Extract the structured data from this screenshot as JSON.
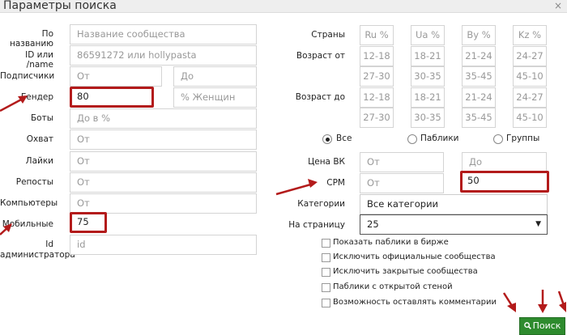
{
  "window": {
    "title": "Параметры поиска",
    "close_glyph": "×"
  },
  "left": {
    "by_name": {
      "label": "По названию",
      "placeholder": "Название сообщества"
    },
    "id_name": {
      "label": "ID или /name",
      "placeholder": "86591272 или hollypasta"
    },
    "subscribers": {
      "label": "Подписчики",
      "from": "От",
      "to": "До"
    },
    "gender": {
      "label": "Гендер",
      "value": "80",
      "suffix": "% Женщин"
    },
    "bots": {
      "label": "Боты",
      "placeholder": "До в %"
    },
    "reach": {
      "label": "Охват",
      "placeholder": "От"
    },
    "likes": {
      "label": "Лайки",
      "placeholder": "От"
    },
    "reposts": {
      "label": "Репосты",
      "placeholder": "От"
    },
    "computers": {
      "label": "Компьютеры",
      "placeholder": "От"
    },
    "mobile": {
      "label": "Мобильные",
      "value": "75"
    },
    "admin_id": {
      "label_line1": "Id",
      "label_line2": "администратора",
      "placeholder": "id"
    }
  },
  "right": {
    "countries": {
      "label": "Страны",
      "items": [
        "Ru %",
        "Ua %",
        "By %",
        "Kz %"
      ]
    },
    "age_from": {
      "label": "Возраст от",
      "row1": [
        "12-18",
        "18-21",
        "21-24",
        "24-27"
      ],
      "row2": [
        "27-30",
        "30-35",
        "35-45",
        "45-10"
      ]
    },
    "age_to": {
      "label": "Возраст до",
      "row1": [
        "12-18",
        "18-21",
        "21-24",
        "24-27"
      ],
      "row2": [
        "27-30",
        "30-35",
        "35-45",
        "45-10"
      ]
    },
    "type": {
      "all": "Все",
      "publics": "Паблики",
      "groups": "Группы",
      "selected": "all"
    },
    "price_vk": {
      "label": "Цена ВК",
      "from": "От",
      "to": "До"
    },
    "cpm": {
      "label": "CPM",
      "from": "От",
      "to_value": "50"
    },
    "categories": {
      "label": "Категории",
      "value": "Все категории"
    },
    "per_page": {
      "label": "На страницу",
      "value": "25"
    },
    "checkboxes": [
      "Показать паблики в бирже",
      "Исключить официальные сообщества",
      "Исключить закрытые сообщества",
      "Паблики с открытой стеной",
      "Возможность оставлять комментарии"
    ]
  },
  "search_button": {
    "icon": "search-icon",
    "label": "Поиск"
  },
  "colors": {
    "highlight": "#b31b1b",
    "button": "#2e8b2e"
  }
}
